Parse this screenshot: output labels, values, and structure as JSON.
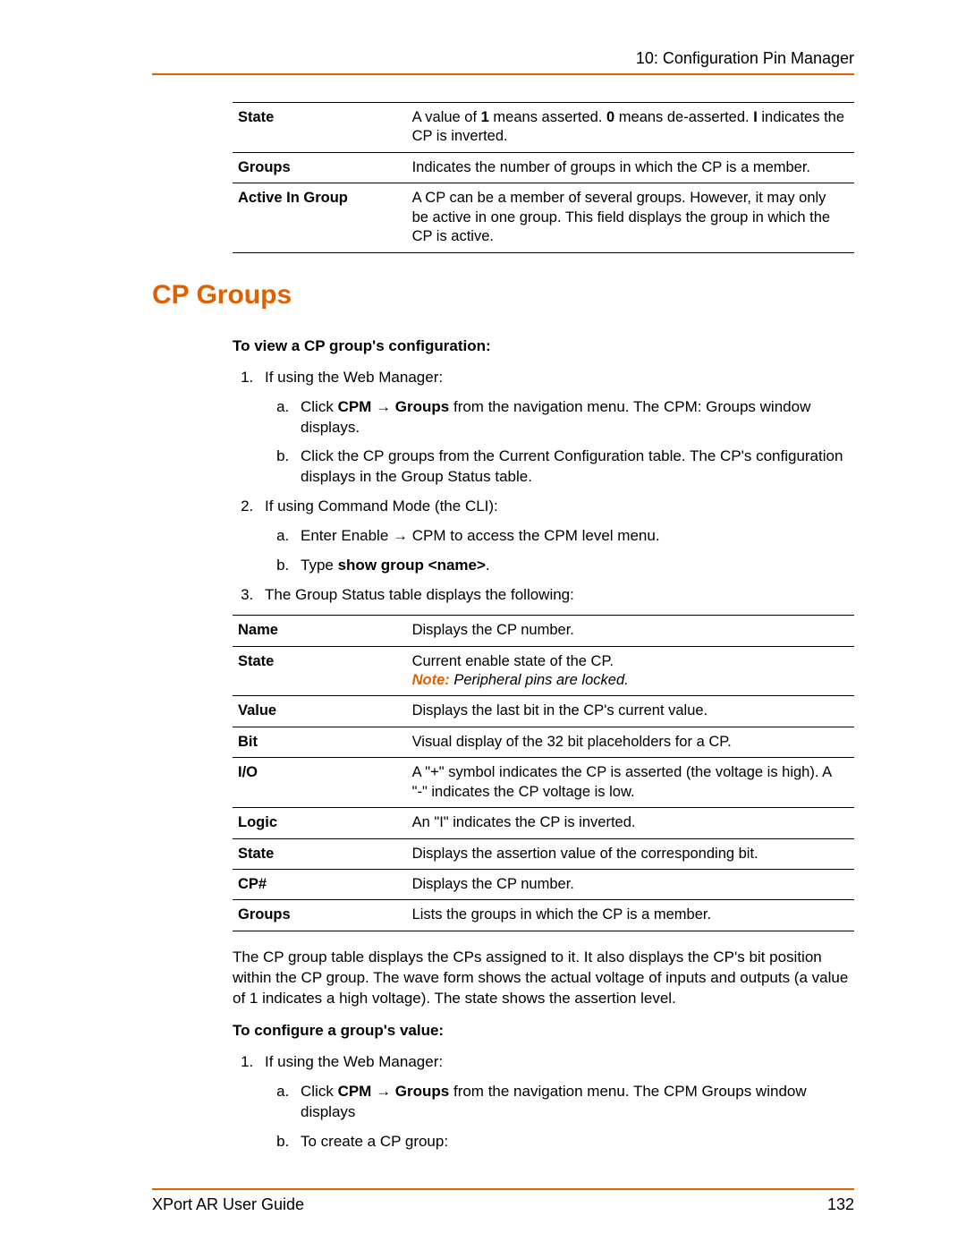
{
  "header": {
    "title": "10: Configuration Pin Manager"
  },
  "footer": {
    "guide": "XPort AR User Guide",
    "page": "132"
  },
  "table1": {
    "rows": [
      {
        "term": "State",
        "desc_parts": [
          "A value of ",
          "1",
          " means asserted. ",
          "0",
          " means de-asserted. ",
          "I",
          " indicates the CP is inverted."
        ]
      },
      {
        "term": "Groups",
        "desc": "Indicates the number of groups in which the CP is a member."
      },
      {
        "term": "Active In Group",
        "desc": "A CP can be a member of several groups. However, it may only be active in one group.  This field displays the group in which the CP is active."
      }
    ]
  },
  "section_title": "CP Groups",
  "sub1": "To view a CP group's configuration:",
  "steps1": {
    "s1": "If using the Web Manager:",
    "s1a_prefix": "Click ",
    "s1a_bold1": "CPM",
    "s1a_arrow": " → ",
    "s1a_bold2": "Groups",
    "s1a_rest": " from the navigation menu.  The CPM: Groups window displays.",
    "s1b": "Click the CP groups from the Current Configuration table.  The CP's configuration displays in the Group Status table.",
    "s2": "If using Command Mode (the CLI):",
    "s2a": "Enter Enable → CPM to access the CPM level menu.",
    "s2b_prefix": "Type ",
    "s2b_bold": "show group <name>",
    "s2b_suffix": ".",
    "s3": "The Group Status table displays the following:"
  },
  "table2": {
    "rows": [
      {
        "term": "Name",
        "desc": "Displays the CP number."
      },
      {
        "term": "State",
        "desc": "Current enable state of the CP.",
        "note_label": "Note:",
        "note_text": " Peripheral pins are locked."
      },
      {
        "term": "Value",
        "desc": "Displays the last bit in the CP's current value."
      },
      {
        "term": "Bit",
        "desc": "Visual display of the 32 bit placeholders for a CP."
      },
      {
        "term": "I/O",
        "desc": "A \"+\" symbol indicates the CP is asserted (the voltage is high).  A \"-\" indicates the CP voltage is low."
      },
      {
        "term": "Logic",
        "desc": "An \"I\" indicates the CP is inverted."
      },
      {
        "term": "State",
        "desc": "Displays the assertion value of the corresponding bit."
      },
      {
        "term": "CP#",
        "desc": "Displays the CP number."
      },
      {
        "term": "Groups",
        "desc": "Lists the groups in which the CP is a member."
      }
    ]
  },
  "para_after": "The CP group table displays the CPs assigned to it.  It also displays the CP's bit position within the CP group.  The wave form shows the actual voltage of inputs and outputs (a value of 1 indicates a high voltage).  The state shows the assertion level.",
  "sub2": "To configure a group's value:",
  "steps2": {
    "s1": "If using the Web Manager:",
    "s1a_prefix": "Click ",
    "s1a_bold1": "CPM",
    "s1a_arrow": " → ",
    "s1a_bold2": "Groups",
    "s1a_rest": " from the navigation menu.  The CPM Groups window displays",
    "s1b": "To create a CP group:"
  }
}
